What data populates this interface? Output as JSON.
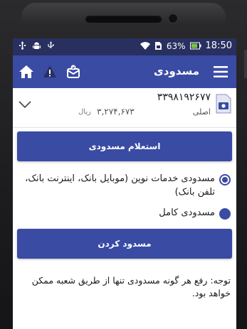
{
  "status_bar": {
    "battery_percent": "63%",
    "time": "18:50"
  },
  "app_bar": {
    "title": "مسدودی",
    "icons": [
      "home-icon",
      "warning-icon",
      "notification-icon",
      "menu-icon"
    ]
  },
  "account": {
    "number": "۳۳۹۸۱۹۲۶۷۷",
    "type": "اصلی",
    "balance": "۳,۲۷۴,۶۷۳",
    "currency": "ریال"
  },
  "actions": {
    "inquiry_label": "استعلام مسدودی",
    "block_label": "مسدود کردن"
  },
  "options": [
    {
      "label": "مسدودی خدمات نوین (موبایل بانک، اینترنت بانک، تلفن بانک)",
      "selected": true
    },
    {
      "label": "مسدودی کامل",
      "selected": false
    }
  ],
  "note": "توجه: رفع هر گونه مسدودی تنها از طریق شعبه ممکن خواهد بود.",
  "colors": {
    "primary": "#3a4ba4",
    "status_bar": "#27305f"
  }
}
